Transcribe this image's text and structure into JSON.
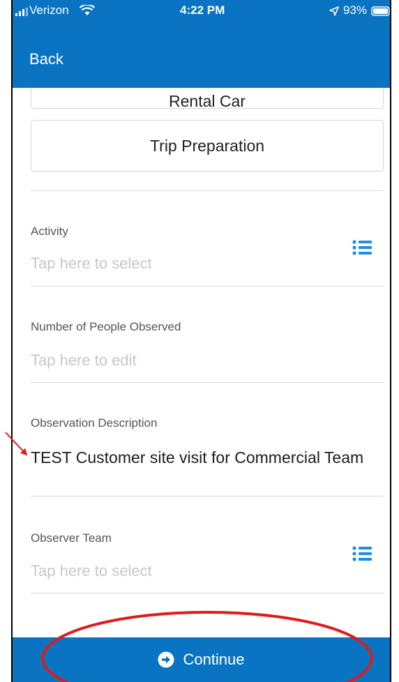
{
  "status_bar": {
    "carrier": "Verizon",
    "time": "4:22 PM",
    "battery": "93%",
    "icons": [
      "signal-icon",
      "wifi-icon",
      "location-arrow-icon",
      "battery-icon"
    ]
  },
  "nav": {
    "back_label": "Back"
  },
  "categories": [
    {
      "label": "Rental Car"
    },
    {
      "label": "Trip Preparation"
    }
  ],
  "fields": {
    "activity": {
      "label": "Activity",
      "placeholder": "Tap here to select"
    },
    "people": {
      "label": "Number of People Observed",
      "placeholder": "Tap here to edit"
    },
    "description": {
      "label": "Observation Description",
      "value": "TEST Customer site visit for Commercial Team"
    },
    "team": {
      "label": "Observer Team",
      "placeholder": "Tap here to select"
    }
  },
  "footer": {
    "continue_label": "Continue"
  },
  "colors": {
    "brand": "#0a74c2",
    "annotation": "#e01b1b"
  }
}
